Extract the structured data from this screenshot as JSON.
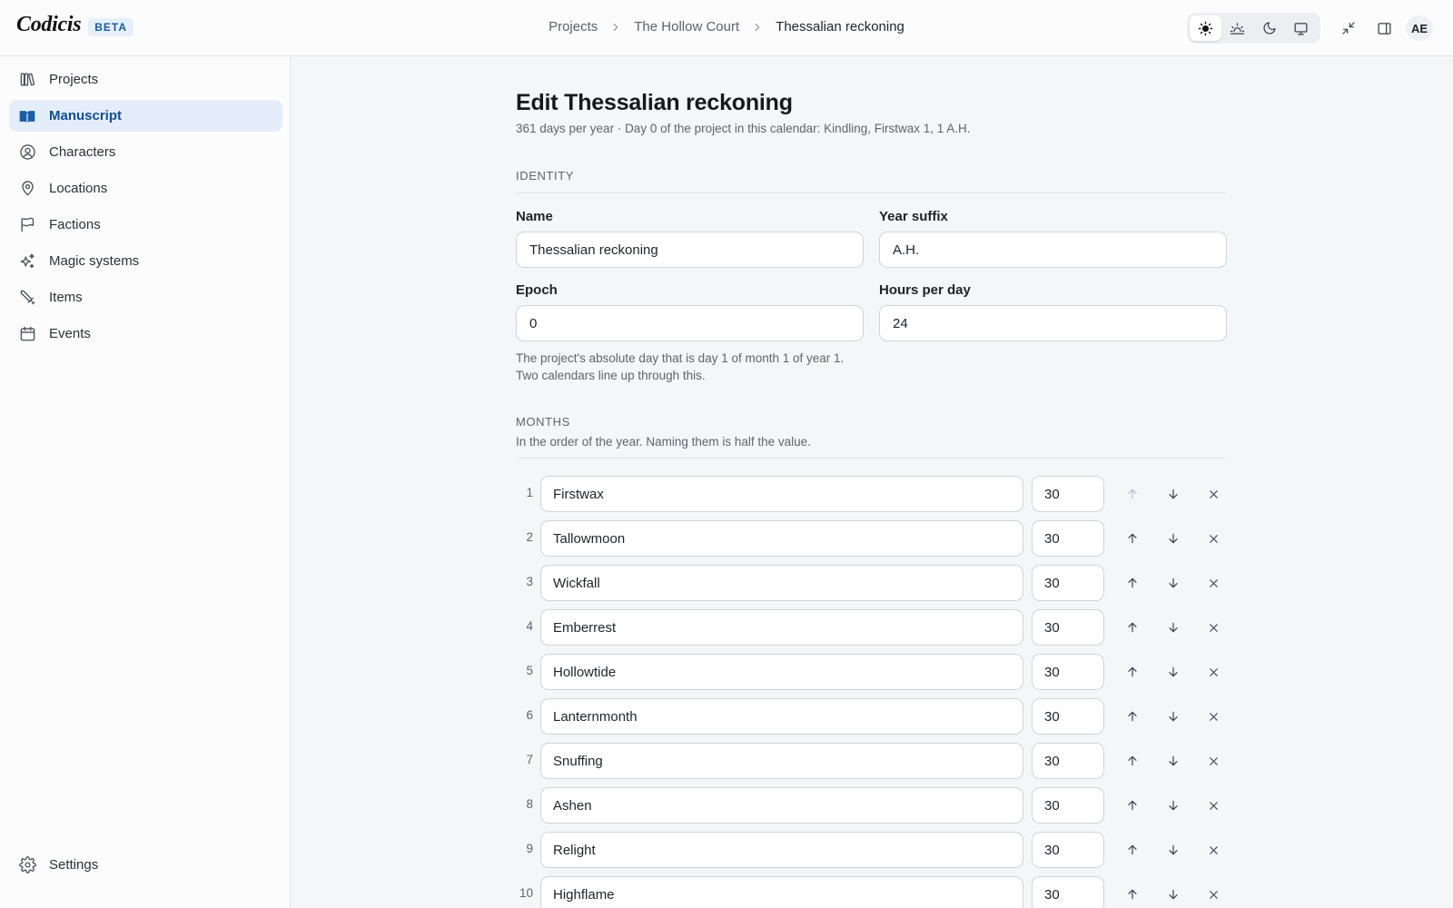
{
  "app": {
    "name": "Codicis",
    "badge": "BETA"
  },
  "breadcrumb": [
    {
      "label": "Projects"
    },
    {
      "label": "The Hollow Court"
    },
    {
      "label": "Thessalian reckoning"
    }
  ],
  "header": {
    "theme_options": [
      "sun-icon",
      "sunrise-icon",
      "moon-icon",
      "monitor-icon"
    ],
    "active_theme": "sun-icon",
    "user_initials": "AE"
  },
  "sidebar": {
    "items": [
      {
        "label": "Projects",
        "icon": "books-icon"
      },
      {
        "label": "Manuscript",
        "icon": "book-open-icon",
        "active": true
      },
      {
        "label": "Characters",
        "icon": "user-circle-icon"
      },
      {
        "label": "Locations",
        "icon": "map-pin-icon"
      },
      {
        "label": "Factions",
        "icon": "flag-icon"
      },
      {
        "label": "Magic systems",
        "icon": "sparkles-icon"
      },
      {
        "label": "Items",
        "icon": "sword-icon"
      },
      {
        "label": "Events",
        "icon": "calendar-icon"
      }
    ],
    "footer": {
      "label": "Settings",
      "icon": "gear-icon"
    }
  },
  "page": {
    "title": "Edit Thessalian reckoning",
    "subtitle": "361 days per year · Day 0 of the project in this calendar: Kindling, Firstwax 1, 1 A.H."
  },
  "identity": {
    "section_title": "IDENTITY",
    "name": {
      "label": "Name",
      "value": "Thessalian reckoning"
    },
    "year_suffix": {
      "label": "Year suffix",
      "value": "A.H."
    },
    "epoch": {
      "label": "Epoch",
      "value": "0"
    },
    "hours_per_day": {
      "label": "Hours per day",
      "value": "24"
    },
    "epoch_help_line1": "The project's absolute day that is day 1 of month 1 of year 1.",
    "epoch_help_line2": "Two calendars line up through this."
  },
  "months": {
    "section_title": "MONTHS",
    "description": "In the order of the year. Naming them is half the value.",
    "items": [
      {
        "index": "1",
        "name": "Firstwax",
        "days": "30"
      },
      {
        "index": "2",
        "name": "Tallowmoon",
        "days": "30"
      },
      {
        "index": "3",
        "name": "Wickfall",
        "days": "30"
      },
      {
        "index": "4",
        "name": "Emberrest",
        "days": "30"
      },
      {
        "index": "5",
        "name": "Hollowtide",
        "days": "30"
      },
      {
        "index": "6",
        "name": "Lanternmonth",
        "days": "30"
      },
      {
        "index": "7",
        "name": "Snuffing",
        "days": "30"
      },
      {
        "index": "8",
        "name": "Ashen",
        "days": "30"
      },
      {
        "index": "9",
        "name": "Relight",
        "days": "30"
      },
      {
        "index": "10",
        "name": "Highflame",
        "days": "30"
      }
    ]
  }
}
